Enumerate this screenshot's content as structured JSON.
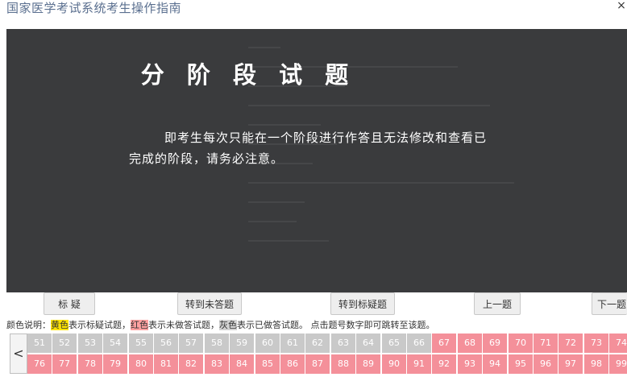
{
  "window": {
    "title": "国家医学考试系统考生操作指南",
    "close_label": "×"
  },
  "overlay": {
    "heading": "分 阶 段 试 题",
    "text": "即考生每次只能在一个阶段进行作答且无法修改和查看已完成的阶段，请务必注意。"
  },
  "toolbar": {
    "mark_label": "标 疑",
    "goto_unanswered_label": "转到未答题",
    "goto_marked_label": "转到标疑题",
    "prev_label": "上一题",
    "next_label": "下一题"
  },
  "legend": {
    "intro": "颜色说明：",
    "yellow_word": "黄色",
    "yellow_desc": "表示标疑试题，",
    "red_word": "红色",
    "red_desc": "表示未做答试题，",
    "gray_word": "灰色",
    "gray_desc": "表示已做答试题。 点击题号数字即可跳转至该题。"
  },
  "colors": {
    "answered": "#c9c9c9",
    "unanswered": "#f4909a",
    "marked": "#ffe400",
    "overlay_bg": "#3a3b3d"
  },
  "question_grid": {
    "prev_arrow": "<",
    "rows": [
      [
        {
          "n": "51",
          "state": "answered"
        },
        {
          "n": "52",
          "state": "answered"
        },
        {
          "n": "53",
          "state": "answered"
        },
        {
          "n": "54",
          "state": "answered"
        },
        {
          "n": "55",
          "state": "answered"
        },
        {
          "n": "56",
          "state": "answered"
        },
        {
          "n": "57",
          "state": "answered"
        },
        {
          "n": "58",
          "state": "answered"
        },
        {
          "n": "59",
          "state": "answered"
        },
        {
          "n": "60",
          "state": "answered"
        },
        {
          "n": "61",
          "state": "answered"
        },
        {
          "n": "62",
          "state": "answered"
        },
        {
          "n": "63",
          "state": "answered"
        },
        {
          "n": "64",
          "state": "answered"
        },
        {
          "n": "65",
          "state": "answered"
        },
        {
          "n": "66",
          "state": "answered"
        },
        {
          "n": "67",
          "state": "unanswered"
        },
        {
          "n": "68",
          "state": "unanswered"
        },
        {
          "n": "69",
          "state": "unanswered"
        },
        {
          "n": "70",
          "state": "unanswered"
        },
        {
          "n": "71",
          "state": "unanswered"
        },
        {
          "n": "72",
          "state": "unanswered"
        },
        {
          "n": "73",
          "state": "unanswered"
        },
        {
          "n": "74",
          "state": "unanswered"
        }
      ],
      [
        {
          "n": "76",
          "state": "unanswered"
        },
        {
          "n": "77",
          "state": "unanswered"
        },
        {
          "n": "78",
          "state": "unanswered"
        },
        {
          "n": "79",
          "state": "unanswered"
        },
        {
          "n": "80",
          "state": "unanswered"
        },
        {
          "n": "81",
          "state": "unanswered"
        },
        {
          "n": "82",
          "state": "unanswered"
        },
        {
          "n": "83",
          "state": "unanswered"
        },
        {
          "n": "84",
          "state": "unanswered"
        },
        {
          "n": "85",
          "state": "unanswered"
        },
        {
          "n": "86",
          "state": "unanswered"
        },
        {
          "n": "87",
          "state": "unanswered"
        },
        {
          "n": "88",
          "state": "unanswered"
        },
        {
          "n": "89",
          "state": "unanswered"
        },
        {
          "n": "90",
          "state": "unanswered"
        },
        {
          "n": "91",
          "state": "unanswered"
        },
        {
          "n": "92",
          "state": "unanswered"
        },
        {
          "n": "93",
          "state": "unanswered"
        },
        {
          "n": "94",
          "state": "unanswered"
        },
        {
          "n": "95",
          "state": "unanswered"
        },
        {
          "n": "96",
          "state": "unanswered"
        },
        {
          "n": "97",
          "state": "unanswered"
        },
        {
          "n": "98",
          "state": "unanswered"
        },
        {
          "n": "99",
          "state": "unanswered"
        }
      ]
    ]
  }
}
